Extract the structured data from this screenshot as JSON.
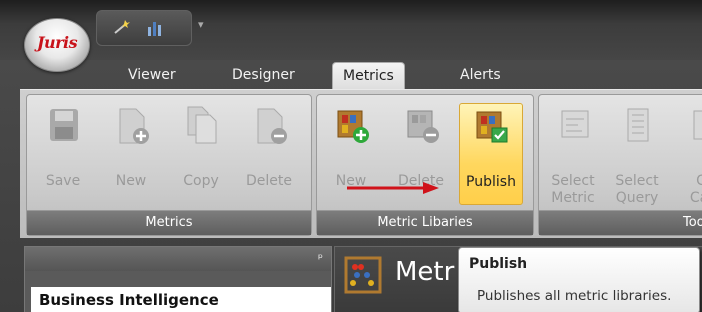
{
  "app": {
    "logo_text": "Juris"
  },
  "tabs": [
    {
      "label": "Viewer",
      "active": false
    },
    {
      "label": "Designer",
      "active": false
    },
    {
      "label": "Metrics",
      "active": true
    },
    {
      "label": "Alerts",
      "active": false
    }
  ],
  "groups": {
    "metrics": {
      "label": "Metrics",
      "buttons": [
        {
          "label": "Save",
          "icon": "floppy-disk-icon",
          "enabled": false
        },
        {
          "label": "New",
          "icon": "new-document-icon",
          "enabled": false
        },
        {
          "label": "Copy",
          "icon": "copy-documents-icon",
          "enabled": false
        },
        {
          "label": "Delete",
          "icon": "delete-document-icon",
          "enabled": false
        }
      ]
    },
    "metric_libraries": {
      "label": "Metric Libaries",
      "buttons": [
        {
          "label": "New",
          "icon": "new-library-icon",
          "enabled": true
        },
        {
          "label": "Delete",
          "icon": "delete-library-icon",
          "enabled": false
        },
        {
          "label": "Publish",
          "icon": "publish-library-icon",
          "enabled": true,
          "highlighted": true
        }
      ]
    },
    "tools": {
      "label": "Tools",
      "buttons": [
        {
          "label": "Select",
          "label2": "Metric",
          "icon": "select-metric-icon",
          "enabled": false
        },
        {
          "label": "Select",
          "label2": "Query",
          "icon": "select-query-icon",
          "enabled": false
        },
        {
          "label": "C",
          "label2": "Cal",
          "icon": "calculate-icon",
          "enabled": false
        }
      ]
    }
  },
  "left_panel": {
    "pin": "ᵖ",
    "section_title": "Business Intelligence"
  },
  "right_panel": {
    "title_partial": "Metr"
  },
  "tooltip": {
    "title": "Publish",
    "body": "Publishes all metric libraries."
  },
  "colors": {
    "accent_red": "#d0121a",
    "highlight": "#ffd75e",
    "ribbon_group_label": "#666666"
  }
}
